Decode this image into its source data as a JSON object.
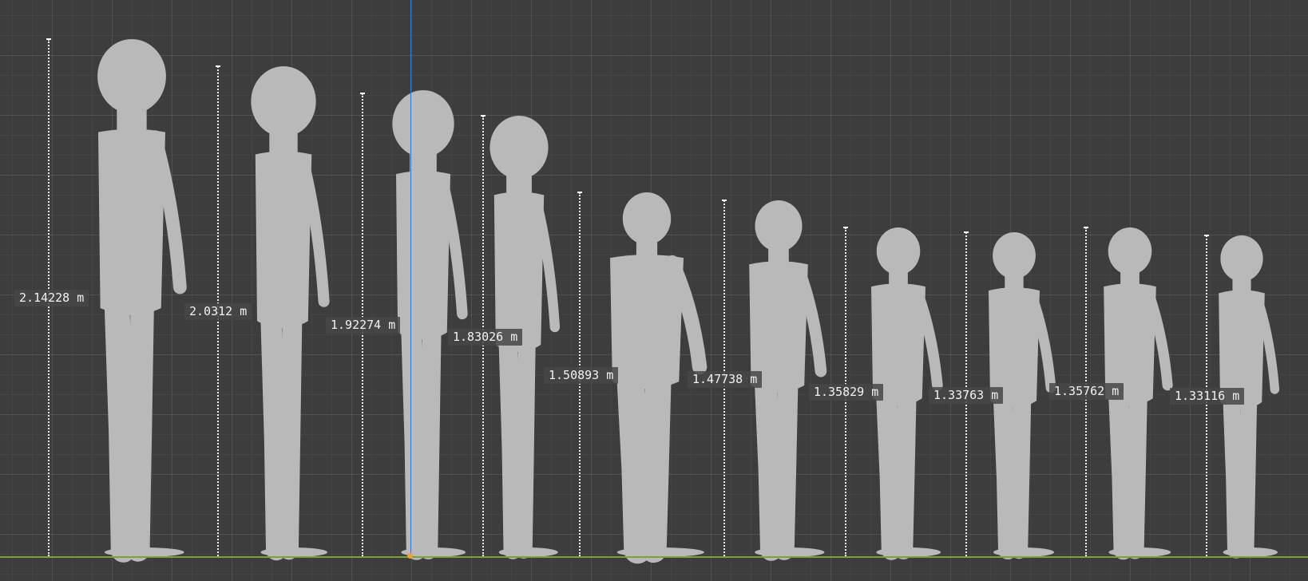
{
  "viewport": {
    "background": "#3d3d3d",
    "grid_color": "#4a4a4a",
    "ground_axis_color": "#7aa33a",
    "y_axis_color": "#3e6fc9",
    "origin_color": "#e8a33a",
    "figure_color": "#b9b9b9"
  },
  "measurements": [
    {
      "label": "2.14228 m",
      "height_m": 2.14228
    },
    {
      "label": "2.0312 m",
      "height_m": 2.0312
    },
    {
      "label": "1.92274 m",
      "height_m": 1.92274
    },
    {
      "label": "1.83026 m",
      "height_m": 1.83026
    },
    {
      "label": "1.50893 m",
      "height_m": 1.50893
    },
    {
      "label": "1.47738 m",
      "height_m": 1.47738
    },
    {
      "label": "1.35829 m",
      "height_m": 1.35829
    },
    {
      "label": "1.33763 m",
      "height_m": 1.33763
    },
    {
      "label": "1.35762 m",
      "height_m": 1.35762
    },
    {
      "label": "1.33116 m",
      "height_m": 1.33116
    }
  ]
}
